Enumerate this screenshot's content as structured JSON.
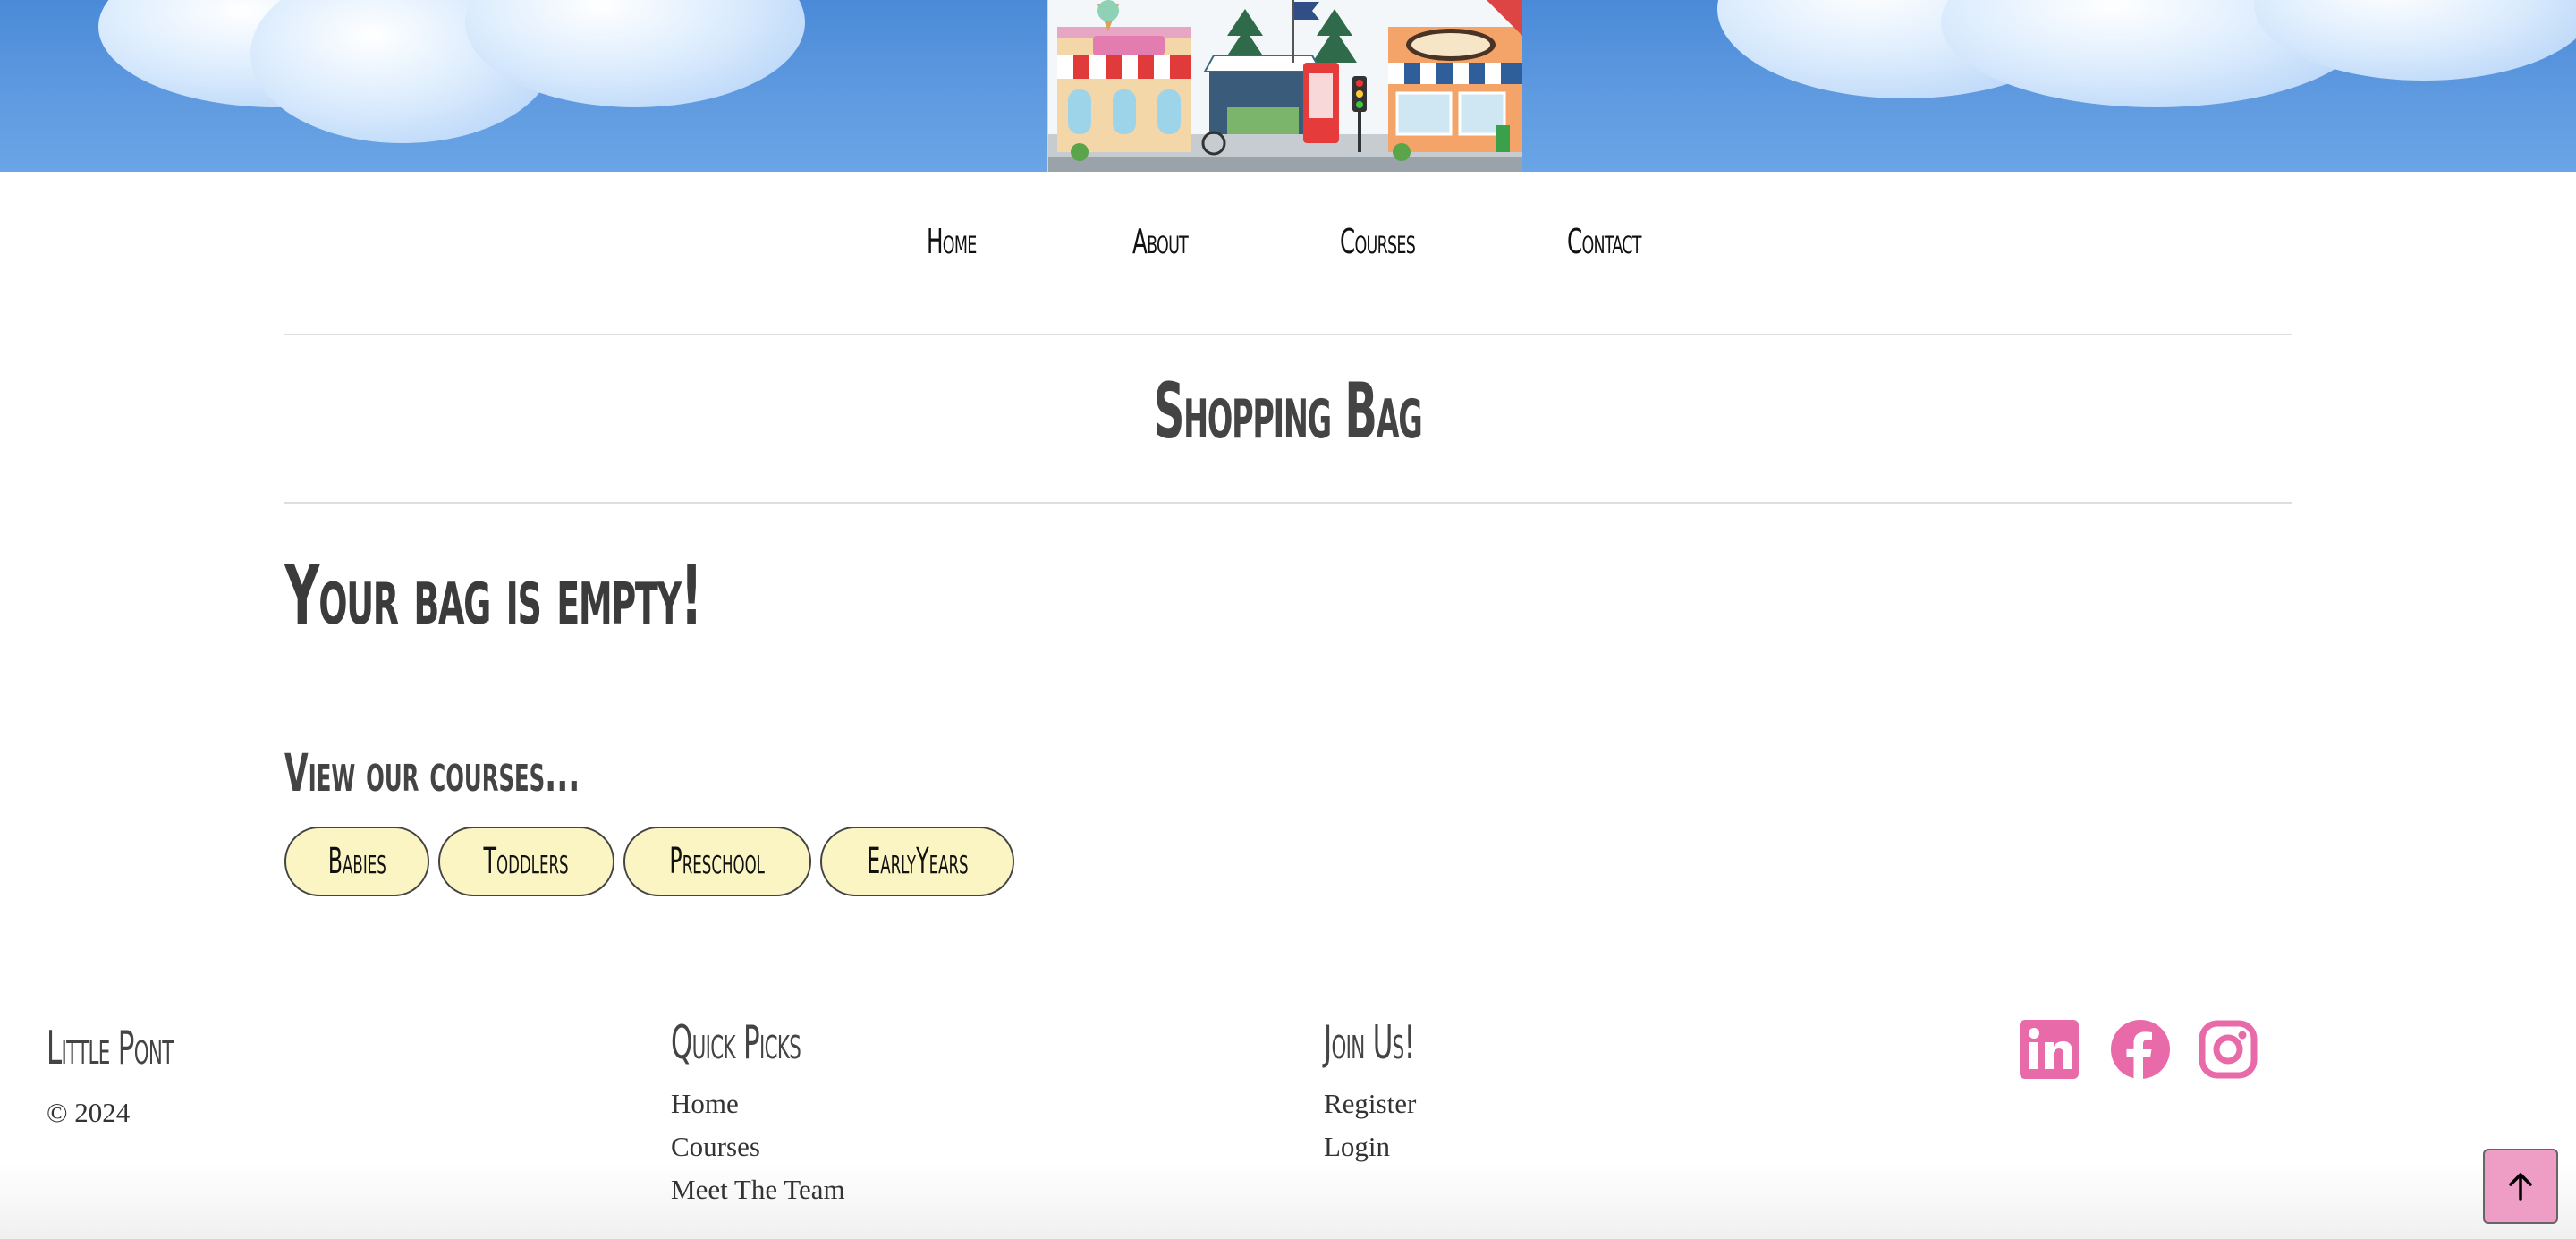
{
  "nav": {
    "items": [
      "Home",
      "About",
      "Courses",
      "Contact"
    ]
  },
  "page": {
    "title": "Shopping Bag",
    "empty_message": "Your bag is empty!",
    "view_courses_label": "View our courses..."
  },
  "courses": {
    "buttons": [
      "Babies",
      "Toddlers",
      "Preschool",
      "EarlyYears"
    ]
  },
  "footer": {
    "brand": "Little Pont",
    "copyright": "© 2024",
    "quick_picks": {
      "title": "Quick Picks",
      "links": [
        "Home",
        "Courses",
        "Meet The Team"
      ]
    },
    "join": {
      "title": "Join Us!",
      "links": [
        "Register",
        "Login"
      ]
    },
    "social": [
      "linkedin-icon",
      "facebook-icon",
      "instagram-icon"
    ],
    "social_color": "#e96aa8"
  },
  "colors": {
    "sky": "#5f9ae0",
    "pill_bg": "#fbf5c3",
    "to_top_bg": "#ee9ec5"
  }
}
